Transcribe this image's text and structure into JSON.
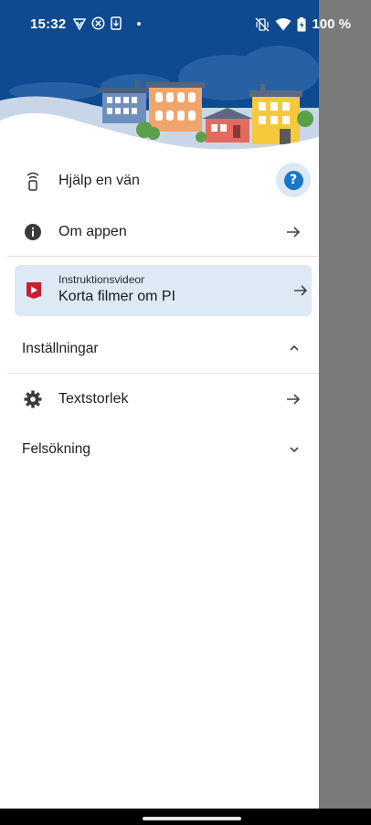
{
  "status_bar": {
    "time": "15:32",
    "left_icons": [
      "vpn-shield-icon",
      "cancel-circle-icon",
      "sim-download-icon",
      "dot-icon"
    ],
    "right_icons": [
      "vibrate-off-icon",
      "wifi-icon",
      "battery-charging-icon"
    ],
    "battery": "100 %"
  },
  "header": {
    "illustration": "town-houses-illustration",
    "colors": {
      "sky": "#0d4a8f",
      "snow": "#eef2f8"
    }
  },
  "menu": {
    "help_friend": {
      "label": "Hjälp en vän",
      "icon": "remote-device-icon",
      "action_icon": "help-question-icon"
    },
    "about": {
      "label": "Om appen",
      "icon": "info-icon",
      "action_icon": "arrow-right-icon"
    },
    "videos": {
      "subtitle": "Instruktionsvideor",
      "title": "Korta filmer om PI",
      "icon": "video-play-icon",
      "action_icon": "arrow-right-icon"
    },
    "settings": {
      "label": "Inställningar",
      "state_icon": "chevron-up-icon"
    },
    "text_size": {
      "label": "Textstorlek",
      "icon": "gear-icon",
      "action_icon": "arrow-right-icon"
    },
    "troubleshooting": {
      "label": "Felsökning",
      "state_icon": "chevron-down-icon"
    }
  },
  "colors": {
    "accent": "#1877c9",
    "card_bg": "#dde9f4",
    "video_icon": "#c8202f"
  }
}
